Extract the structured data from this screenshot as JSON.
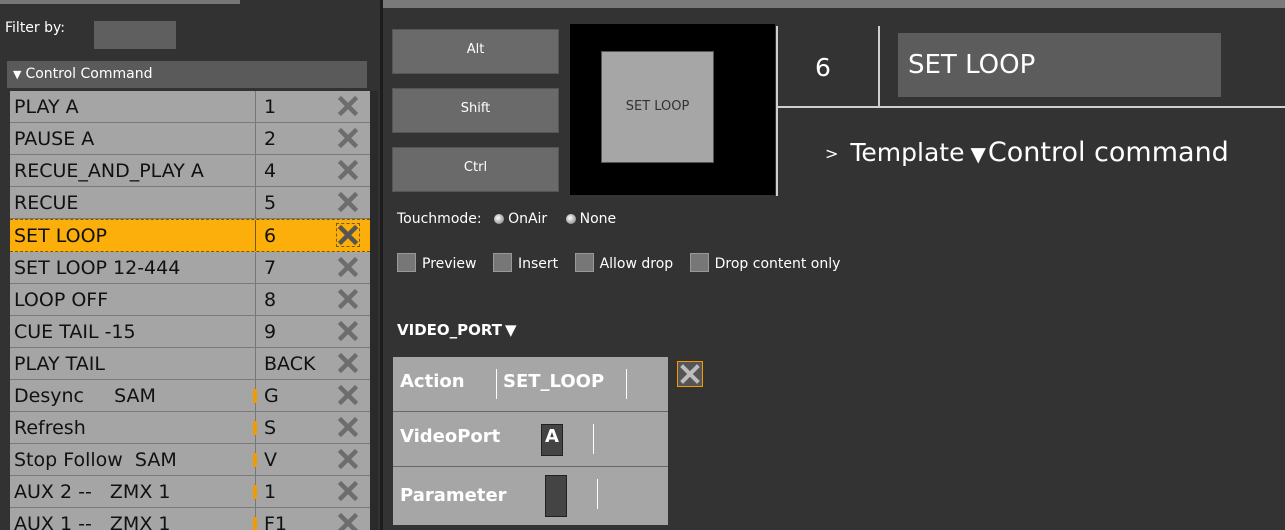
{
  "filter": {
    "label": "Filter by:",
    "value": ""
  },
  "group": {
    "label": "Control Command"
  },
  "commands": [
    {
      "name": "PLAY A",
      "key": "1",
      "marked": false,
      "selected": false
    },
    {
      "name": "PAUSE A",
      "key": "2",
      "marked": false,
      "selected": false
    },
    {
      "name": "RECUE_AND_PLAY A",
      "key": "4",
      "marked": false,
      "selected": false
    },
    {
      "name": "RECUE",
      "key": "5",
      "marked": false,
      "selected": false
    },
    {
      "name": "SET LOOP",
      "key": "6",
      "marked": false,
      "selected": true
    },
    {
      "name": "SET LOOP 12-444",
      "key": "7",
      "marked": false,
      "selected": false
    },
    {
      "name": "LOOP OFF",
      "key": "8",
      "marked": false,
      "selected": false
    },
    {
      "name": "CUE TAIL -15",
      "key": "9",
      "marked": false,
      "selected": false
    },
    {
      "name": "PLAY TAIL",
      "key": "BACK",
      "marked": false,
      "selected": false
    },
    {
      "name": "Desync     SAM",
      "key": "G",
      "marked": true,
      "selected": false
    },
    {
      "name": "Refresh",
      "key": "S",
      "marked": true,
      "selected": false
    },
    {
      "name": "Stop Follow  SAM",
      "key": "V",
      "marked": true,
      "selected": false
    },
    {
      "name": "AUX 2 --   ZMX 1",
      "key": "1",
      "marked": true,
      "selected": false
    },
    {
      "name": "AUX 1 --   ZMX 1",
      "key": "F1",
      "marked": true,
      "selected": false
    }
  ],
  "modifiers": {
    "alt": "Alt",
    "shift": "Shift",
    "ctrl": "Ctrl"
  },
  "preview_button": {
    "label": "SET LOOP"
  },
  "command": {
    "number": "6",
    "title": "SET LOOP"
  },
  "template": {
    "chevron": ">",
    "label": "Template",
    "type": "Control command"
  },
  "touchmode": {
    "label": "Touchmode:",
    "options": [
      "OnAir",
      "None"
    ]
  },
  "options": {
    "preview": "Preview",
    "insert": "Insert",
    "allow_drop": "Allow drop",
    "drop_content_only": "Drop content only"
  },
  "videoport": {
    "header": "VIDEO_PORT",
    "rows": [
      {
        "label": "Action",
        "value": "SET_LOOP"
      },
      {
        "label": "VideoPort",
        "value": "A"
      },
      {
        "label": "Parameter",
        "value": ""
      }
    ]
  },
  "colors": {
    "selected": "#fcae0b",
    "accent_orange": "#f39a00",
    "list_bg": "#a5a5a5",
    "panel_bg": "#333333"
  }
}
